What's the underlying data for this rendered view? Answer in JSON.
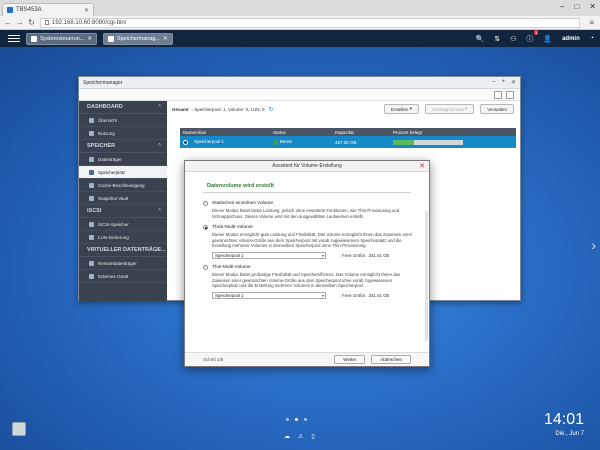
{
  "browser": {
    "tab_title": "TBS453A",
    "url": "192.168.10.60:8080/cgi-bin/"
  },
  "qts": {
    "app_tabs": [
      "Systemsteuerun...",
      "Speichermanag..."
    ],
    "notification_count": "1",
    "user": "admin"
  },
  "window": {
    "title": "Speichermanager",
    "header_label": "Gesamt",
    "header_stats": "- Speicherpool: 1, Volume: 0, LUN: 0",
    "buttons": {
      "create": "Erstellen",
      "snapshot": "Schnappschuss",
      "manage": "Verwalten"
    }
  },
  "sidebar": {
    "sections": [
      {
        "title": "DASHBOARD",
        "items": [
          "Übersicht",
          "Nutzung"
        ]
      },
      {
        "title": "SPEICHER",
        "items": [
          "Datenträger",
          "Speicherplatz",
          "Cache-Beschleunigung",
          "Snapshot Vault"
        ]
      },
      {
        "title": "iSCSI",
        "items": [
          "iSCSI-Speicher",
          "LUN-Sicherung"
        ]
      },
      {
        "title": "VIRTUELLER DATENTRÄGE...",
        "items": [
          "Remotedatenträger",
          "Externes Gerät"
        ]
      }
    ],
    "active_item": "Speicherplatz"
  },
  "table": {
    "headers": [
      "Name/Alias",
      "Status",
      "Kapazität",
      "Prozent belegt"
    ],
    "rows": [
      {
        "name": "Speicherpool 1",
        "status": "Bereit",
        "capacity": "487.00 GB",
        "percent_used": 0.3
      }
    ]
  },
  "wizard": {
    "title": "Assistent für Volume-Erstellung",
    "subtitle": "Datenvolume wird erstellt",
    "options": [
      {
        "label": "Statisches einzelnes Volume",
        "selected": false,
        "desc": "Dieser Modus bietet beste Leistung, jedoch ohne erweiterte Funktionen, wie Thin-Provisioning und Schnappschuss. Dieses Volume wird mit den ausgewählten Laufwerken erstellt."
      },
      {
        "label": "Thick-Multi-Volume",
        "selected": true,
        "desc": "Dieser Modus ermöglicht gute Leistung und Flexibilität. Das Volume ermöglicht Ihnen das Zuweisen einer gewünschten Volume-Größe aus dem Speicherpool mit vorab zugewiesenem Speicherplatz und die Erstellung mehrerer Volumes in demselben Speicherpool ohne Thin-Provisioning.",
        "pool": "Speicherpool 1",
        "free_label": "Freie Größe:",
        "free_value": "341.01 GB"
      },
      {
        "label": "Thin-Multi-Volume",
        "selected": false,
        "desc": "Dieser Modus bietet großartige Flexibilität und Speichereffizienz. Das Volume ermöglicht Ihnen das Zuweisen einer gewünschten Volume-Größe aus dem Speicherpool ohne vorab zugewiesenen Speicherplatz und die Erstellung mehrerer Volumes in demselben Speicherpool.",
        "pool": "Speicherpool 1",
        "free_label": "Freie Größe:",
        "free_value": "341.01 GB"
      }
    ],
    "step": "Schritt 1/5",
    "next": "Weiter",
    "cancel": "Abbrechen"
  },
  "clock": {
    "time": "14:01",
    "date": "Die., Jun 7"
  }
}
